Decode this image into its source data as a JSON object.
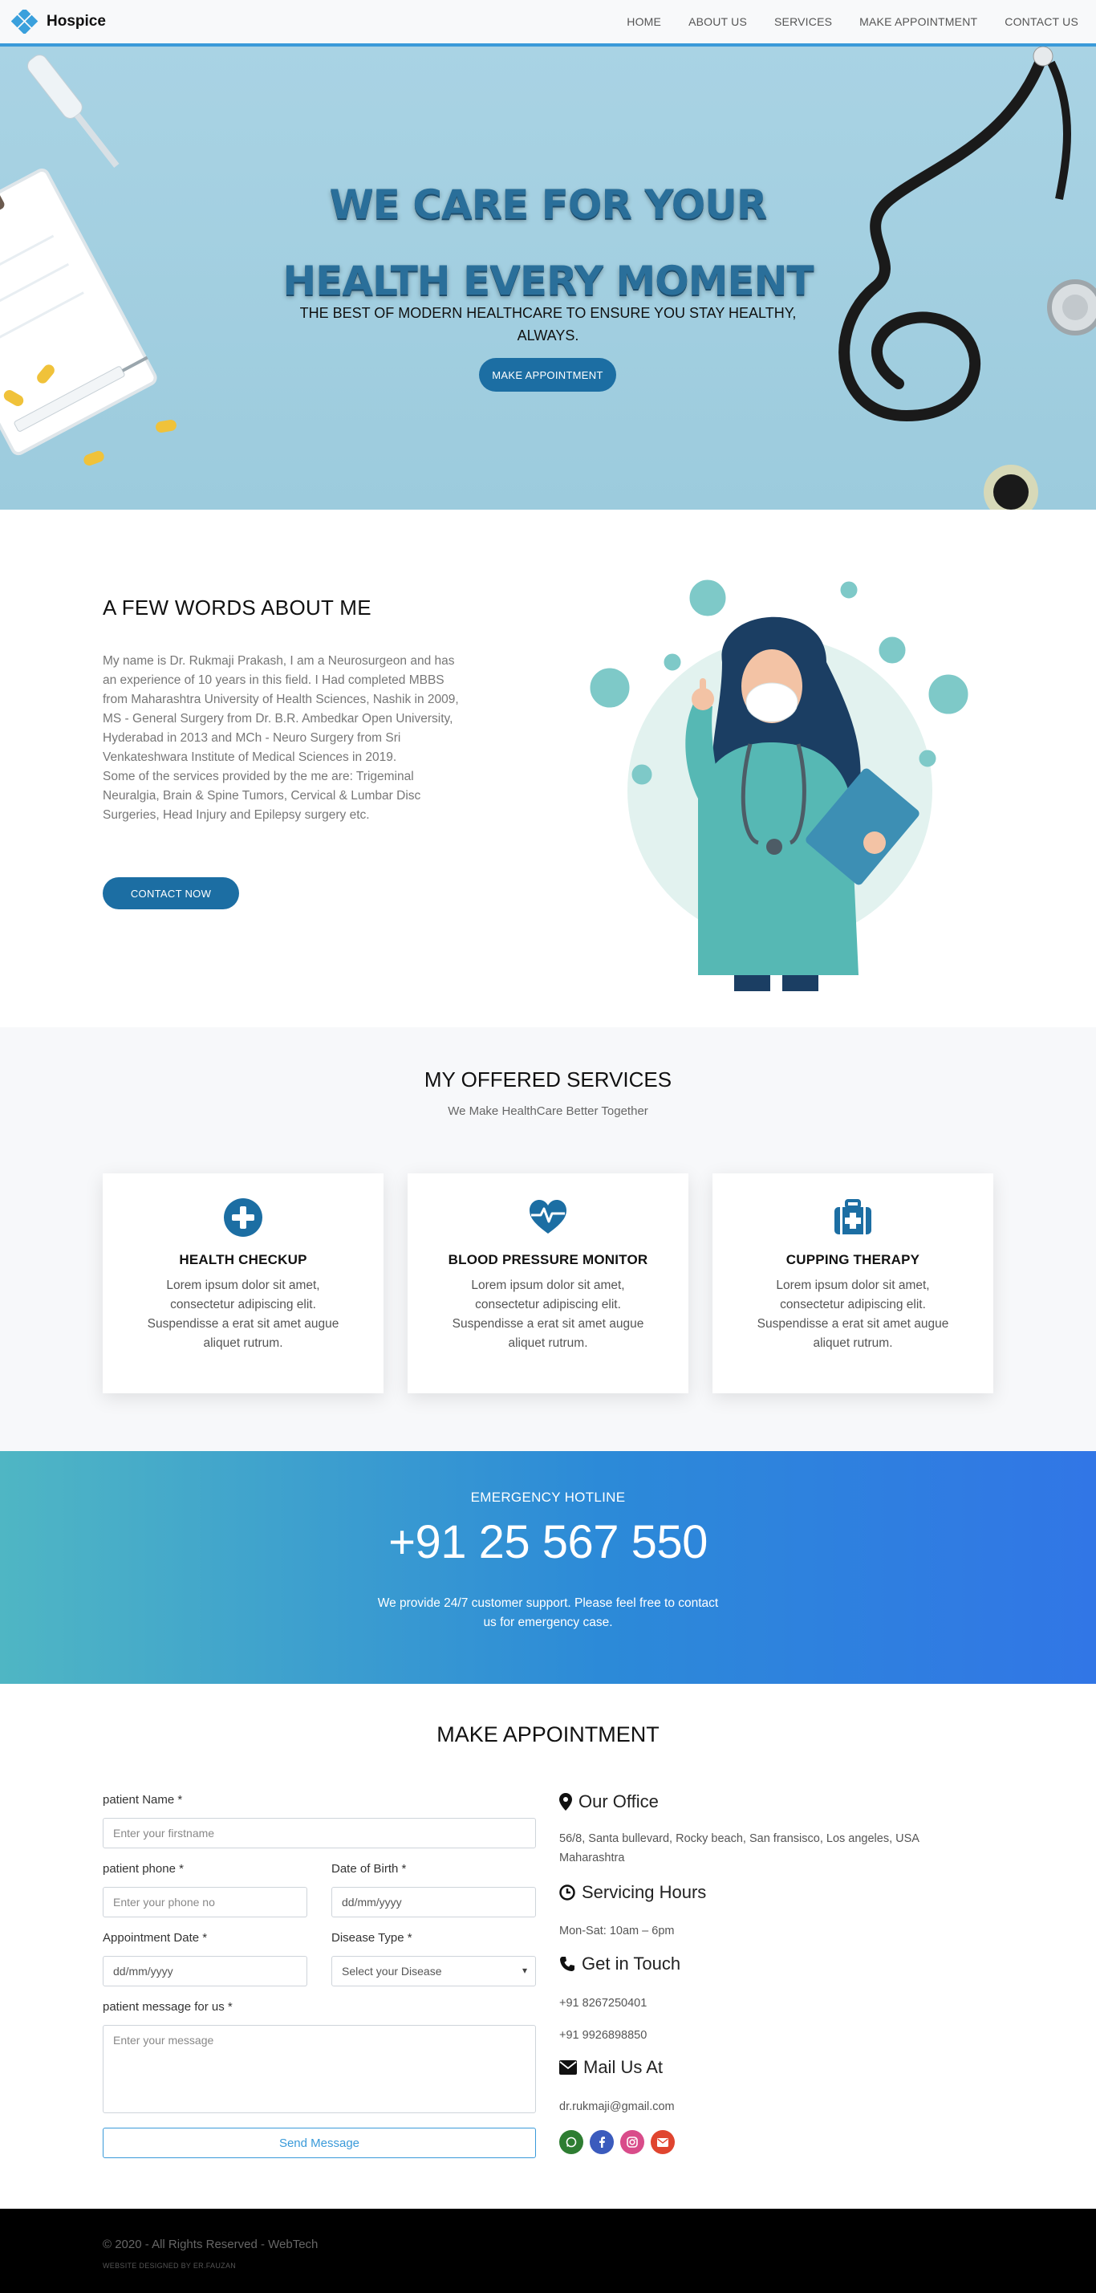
{
  "nav": {
    "brand": "Hospice",
    "links": [
      "HOME",
      "ABOUT US",
      "SERVICES",
      "MAKE APPOINTMENT",
      "CONTACT US"
    ]
  },
  "hero": {
    "title": "WE CARE FOR YOUR\nHEALTH EVERY MOMENT",
    "subtitle": "THE BEST OF MODERN HEALTHCARE TO ENSURE YOU STAY HEALTHY, ALWAYS.",
    "button": "MAKE APPOINTMENT"
  },
  "about": {
    "title": "A FEW WORDS ABOUT ME",
    "text": "My name is Dr. Rukmaji Prakash, I am a Neurosurgeon and has an experience of 10 years in this field. I Had completed MBBS from Maharashtra University of Health Sciences, Nashik in 2009, MS - General Surgery from Dr. B.R. Ambedkar Open University, Hyderabad in 2013 and MCh - Neuro Surgery from Sri Venkateshwara Institute of Medical Sciences in 2019.\nSome of the services provided by the me are: Trigeminal Neuralgia, Brain & Spine Tumors, Cervical & Lumbar Disc Surgeries, Head Injury and Epilepsy surgery etc.",
    "button": "CONTACT NOW"
  },
  "services": {
    "title": "MY OFFERED SERVICES",
    "subtitle": "We Make HealthCare Better Together",
    "cards": [
      {
        "title": "HEALTH CHECKUP",
        "text": "Lorem ipsum dolor sit amet, consectetur adipiscing elit. Suspendisse a erat sit amet augue aliquet rutrum.",
        "icon": "plus-circle-icon"
      },
      {
        "title": "BLOOD PRESSURE MONITOR",
        "text": "Lorem ipsum dolor sit amet, consectetur adipiscing elit. Suspendisse a erat sit amet augue aliquet rutrum.",
        "icon": "heartbeat-icon"
      },
      {
        "title": "CUPPING THERAPY",
        "text": "Lorem ipsum dolor sit amet, consectetur adipiscing elit. Suspendisse a erat sit amet augue aliquet rutrum.",
        "icon": "medical-kit-icon"
      }
    ],
    "accent": "#1c6ea3"
  },
  "hotline": {
    "label": "EMERGENCY HOTLINE",
    "number": "+91 25 567 550",
    "text": "We provide 24/7 customer support. Please feel free to contact us for emergency case."
  },
  "appointment": {
    "title": "MAKE APPOINTMENT",
    "firstname_label": "patient Name *",
    "firstname_placeholder": "Enter your firstname",
    "phone_label": "patient phone *",
    "phone_placeholder": "Enter your phone no",
    "dob_label": "Date of Birth *",
    "dob_placeholder": "dd/mm/yyyy",
    "date_label": "Appointment Date *",
    "date_placeholder": "dd/mm/yyyy",
    "disease_label": "Disease Type *",
    "disease_value": "Select your Disease",
    "message_label": "patient message for us *",
    "message_placeholder": "Enter your message",
    "send": "Send Message"
  },
  "contact": {
    "office_title": "Our Office",
    "office_text": "56/8, Santa bullevard, Rocky beach, San fransisco, Los angeles, USA\nMaharashtra",
    "hours_title": "Servicing Hours",
    "hours_text": "Mon-Sat: 10am – 6pm",
    "touch_title": "Get in Touch",
    "phone1": "+91 8267250401",
    "phone2": "+91 9926898850",
    "mail_title": "Mail Us At",
    "email": "dr.rukmaji@gmail.com",
    "socials": [
      {
        "icon": "whatsapp-icon",
        "color": "#2e7d32"
      },
      {
        "icon": "facebook-icon",
        "color": "#3b5bbd"
      },
      {
        "icon": "instagram-icon",
        "color": "#d94c8a"
      },
      {
        "icon": "email-icon",
        "color": "#e0452f"
      }
    ]
  },
  "footer": {
    "copyright": "© 2020 - All Rights Reserved - WebTech",
    "credit": "WEBSITE DESIGNED BY ER.FAUZAN"
  }
}
